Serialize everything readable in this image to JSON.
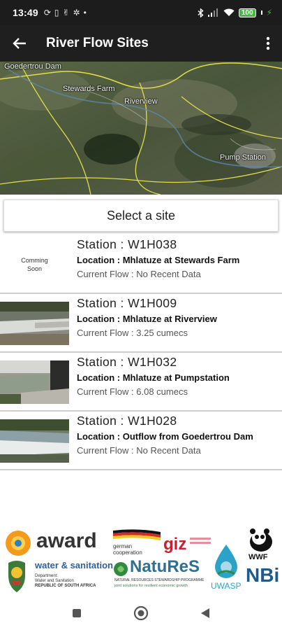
{
  "status_bar": {
    "time": "13:49",
    "left_icons": [
      "sync-icon",
      "sim-icon",
      "gesture-icon",
      "bug-icon",
      "dot-icon"
    ],
    "right_icons": [
      "bluetooth-icon",
      "signal-icon",
      "wifi-icon"
    ],
    "battery": "100",
    "battery_color": "#3cc03c"
  },
  "app_bar": {
    "title": "River Flow Sites",
    "back_icon": "arrow-left-icon",
    "menu_icon": "more-vert-icon"
  },
  "map": {
    "labels": [
      "Goedertrou Dam",
      "Stewards Farm",
      "Riverview",
      "Pump Station"
    ]
  },
  "select_site": {
    "label": "Select a site"
  },
  "stations": [
    {
      "name": "Station : W1H038",
      "location_label": "Location :",
      "location": " Mhlatuze at Stewards Farm",
      "flow": "Current Flow : No Recent Data",
      "thumb": "Comming\nSoon"
    },
    {
      "name": "Station : W1H009",
      "location_label": "Location :",
      "location": " Mhlatuze at Riverview",
      "flow": "Current Flow : 3.25 cumecs",
      "thumb": ""
    },
    {
      "name": "Station : W1H032",
      "location_label": "Location :",
      "location": " Mhlatuze at Pumpstation",
      "flow": "Current Flow : 6.08 cumecs",
      "thumb": ""
    },
    {
      "name": "Station : W1H028",
      "location_label": "Location :",
      "location": " Outflow from Goedertrou Dam",
      "flow": "Current Flow : No Recent Data",
      "thumb": ""
    }
  ],
  "logos": {
    "award": "award",
    "water_sanitation": "water & sanitation",
    "dept_line1": "Department:",
    "dept_line2": "Water and Sanitation",
    "dept_line3": "REPUBLIC OF SOUTH AFRICA",
    "german": "german",
    "cooperation": "cooperation",
    "giz": "giz",
    "natures": "NatuReS",
    "natures_sub": "NATURAL RESOURCES STEWARDSHIP PROGRAMME",
    "natures_sub2": "joint solutions for resilient economic growth",
    "uwasp": "UWASP",
    "wwf": "WWF",
    "nbi": "NBi"
  },
  "nav_bar": {
    "recents_icon": "square-icon",
    "home_icon": "circle-home-icon",
    "back_icon": "triangle-back-icon"
  }
}
